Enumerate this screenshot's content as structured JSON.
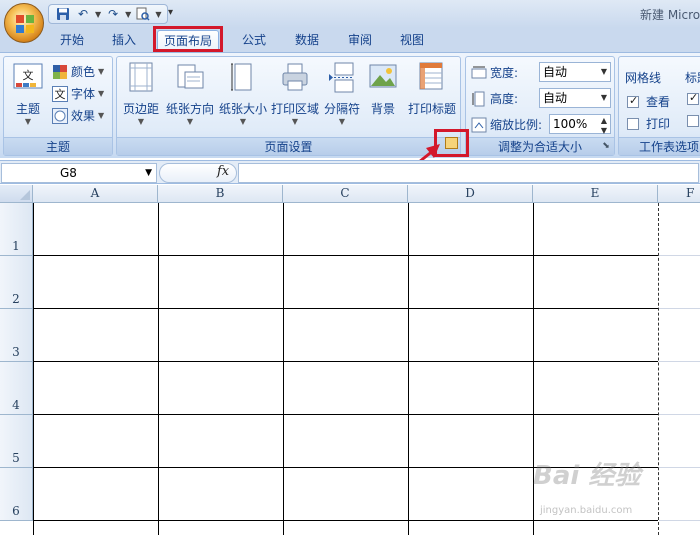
{
  "title_bar": {
    "title": "新建 Micro"
  },
  "tabs": [
    {
      "label": "开始"
    },
    {
      "label": "插入"
    },
    {
      "label": "页面布局",
      "active": true
    },
    {
      "label": "公式"
    },
    {
      "label": "数据"
    },
    {
      "label": "审阅"
    },
    {
      "label": "视图"
    }
  ],
  "ribbon": {
    "themes": {
      "label": "主题",
      "theme_button": "主题",
      "colors": "颜色",
      "fonts": "字体",
      "effects": "效果",
      "font_icon_text": "文",
      "theme_icon_text": "文"
    },
    "page_setup": {
      "label": "页面设置",
      "margins": "页边距",
      "orientation": "纸张方向",
      "size": "纸张大小",
      "print_area": "打印区域",
      "breaks": "分隔符",
      "background": "背景",
      "print_titles": "打印标题"
    },
    "scale_to_fit": {
      "label": "调整为合适大小",
      "width_label": "宽度:",
      "width_value": "自动",
      "height_label": "高度:",
      "height_value": "自动",
      "scale_label": "缩放比例:",
      "scale_value": "100%"
    },
    "sheet_options": {
      "label": "工作表选项",
      "gridlines": "网格线",
      "headings": "标题",
      "view": "查看",
      "print": "打印"
    }
  },
  "formula_bar": {
    "name_box": "G8",
    "fx": "fx",
    "formula": ""
  },
  "grid": {
    "columns": [
      "A",
      "B",
      "C",
      "D",
      "E",
      "F"
    ],
    "rows": [
      "1",
      "2",
      "3",
      "4",
      "5",
      "6"
    ]
  },
  "watermark": {
    "main": "Bai 经验",
    "sub": "jingyan.baidu.com"
  },
  "colors": {
    "highlight": "#d3182b",
    "ribbon_text": "#15428b"
  }
}
